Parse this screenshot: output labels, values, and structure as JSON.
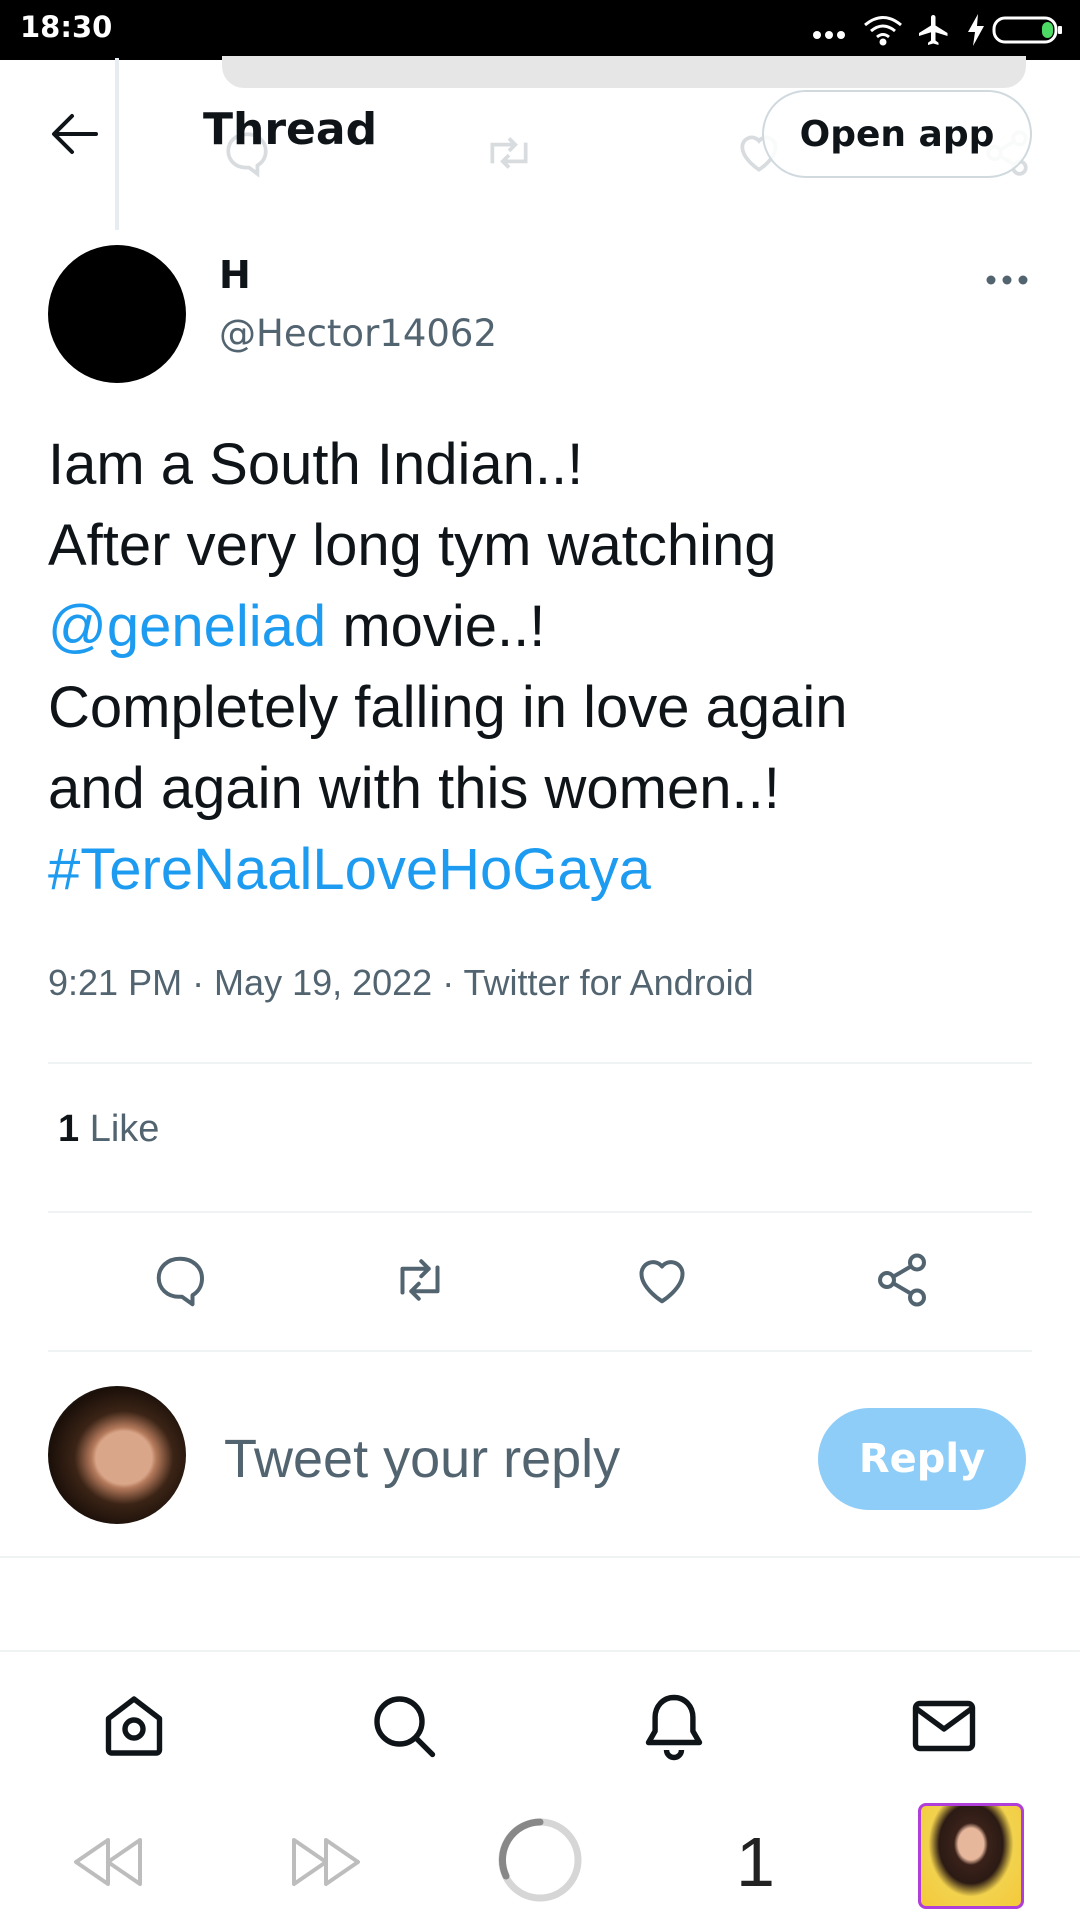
{
  "status_bar": {
    "time": "18:30",
    "icons": [
      "more-dots-icon",
      "wifi-icon",
      "airplane-icon",
      "charging-bolt-icon",
      "battery-icon"
    ]
  },
  "header": {
    "title": "Thread",
    "open_app_label": "Open app",
    "back_icon": "arrow-left-icon"
  },
  "tweet": {
    "author_name": "H",
    "author_handle": "@Hector14062",
    "lines": [
      "Iam a South Indian..!",
      "After very long tym watching",
      "movie..!",
      "Completely falling in love again",
      "and again with this women..!"
    ],
    "mention": "@geneliad",
    "hashtag": "#TereNaalLoveHoGaya",
    "meta": "9:21 PM · May 19, 2022 · Twitter for Android",
    "like_count": "1",
    "like_label": "Like"
  },
  "actions": [
    "reply-icon",
    "retweet-icon",
    "like-icon",
    "share-icon"
  ],
  "reply_box": {
    "placeholder": "Tweet your reply",
    "button_label": "Reply"
  },
  "bottom_nav": [
    "home-icon",
    "search-icon",
    "notifications-icon",
    "messages-icon"
  ],
  "browser_bar": {
    "tab_count": "1",
    "buttons": [
      "rewind-icon",
      "fast-forward-icon",
      "loading-spinner-icon",
      "profile-thumbnail"
    ]
  },
  "colors": {
    "link": "#1d9bf0",
    "text": "#0f1419",
    "secondary": "#536471",
    "reply_button": "#8ecdf8",
    "divider": "#eff3f4"
  }
}
